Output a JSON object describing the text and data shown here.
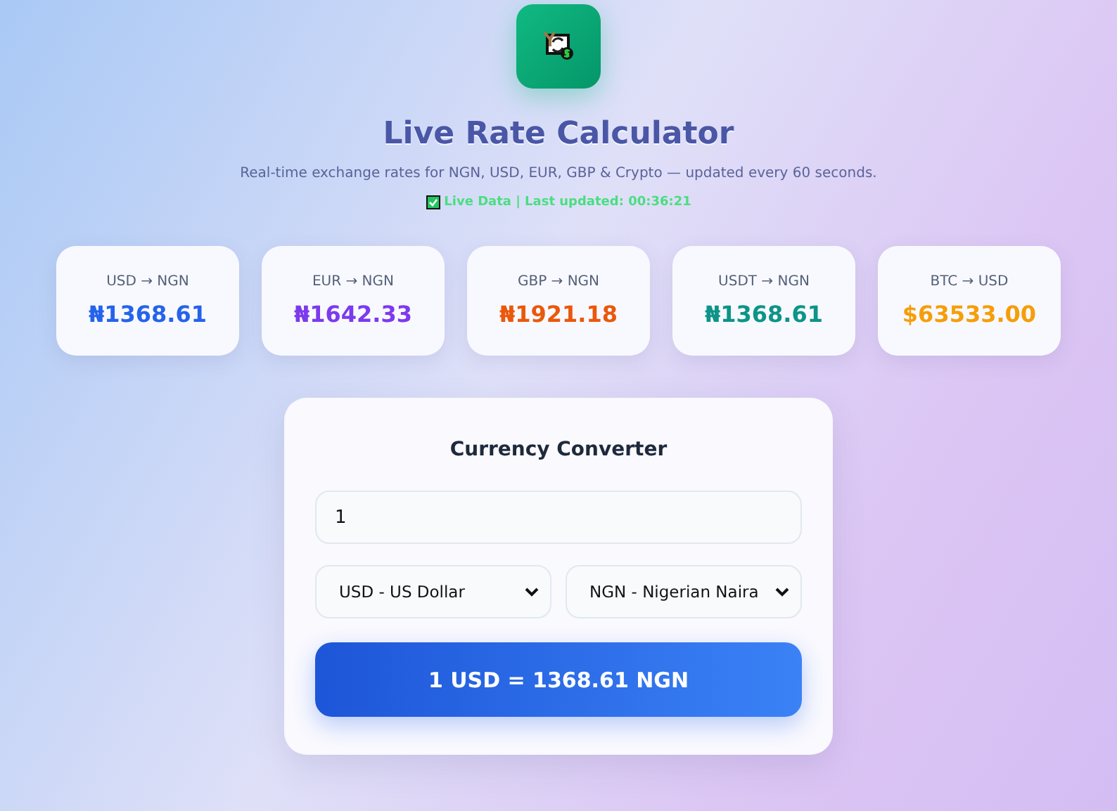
{
  "header": {
    "title": "Live Rate Calculator",
    "subtitle": "Real-time exchange rates for NGN, USD, EUR, GBP & Crypto — updated every 60 seconds.",
    "status": "Live Data | Last updated: 00:36:21"
  },
  "rates": [
    {
      "pair": "USD → NGN",
      "value": "₦1368.61",
      "color": "#2563eb"
    },
    {
      "pair": "EUR → NGN",
      "value": "₦1642.33",
      "color": "#7c3aed"
    },
    {
      "pair": "GBP → NGN",
      "value": "₦1921.18",
      "color": "#ea580c"
    },
    {
      "pair": "USDT → NGN",
      "value": "₦1368.61",
      "color": "#0d9488"
    },
    {
      "pair": "BTC → USD",
      "value": "$63533.00",
      "color": "#f59e0b"
    }
  ],
  "converter": {
    "title": "Currency Converter",
    "amount": "1",
    "from": "USD - US Dollar",
    "to": "NGN - Nigerian Naira",
    "result": "1 USD = 1368.61 NGN"
  }
}
